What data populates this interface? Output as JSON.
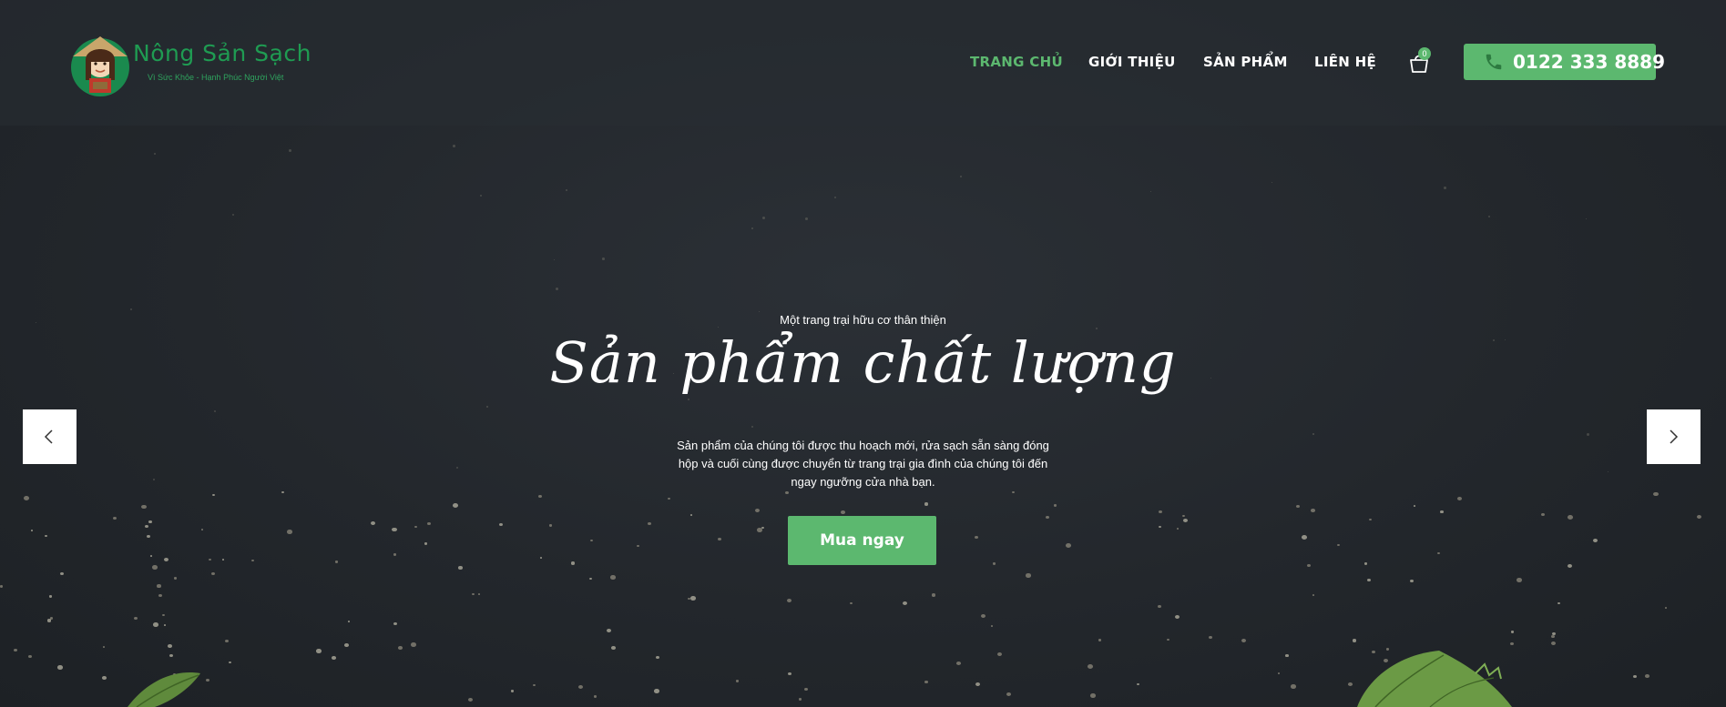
{
  "header": {
    "logo": {
      "title": "Nông Sản Sạch",
      "tagline": "Vì Sức Khỏe - Hạnh Phúc Người Việt"
    },
    "nav": [
      {
        "label": "TRANG CHỦ",
        "active": true
      },
      {
        "label": "GIỚI THIỆU",
        "active": false
      },
      {
        "label": "SẢN PHẨM",
        "active": false
      },
      {
        "label": "LIÊN HỆ",
        "active": false
      }
    ],
    "cart": {
      "icon": "shopping-bag-icon",
      "count": "0"
    },
    "phone": {
      "icon": "phone-icon",
      "number": "0122 333 8889"
    }
  },
  "hero": {
    "subtitle": "Một trang trại hữu cơ thân thiện",
    "title": "Sản phẩm chất lượng",
    "description": "Sản phẩm của chúng tôi được thu hoạch mới, rửa sạch sẵn sàng đóng hộp và cuối cùng được chuyển từ trang trại gia đình của chúng tôi đến ngay ngưỡng cửa nhà bạn.",
    "cta_label": "Mua ngay"
  },
  "slider": {
    "prev_icon": "chevron-left-icon",
    "next_icon": "chevron-right-icon"
  },
  "colors": {
    "accent": "#5cb86f",
    "logo_green": "#1f9b52",
    "background": "#23272c"
  }
}
